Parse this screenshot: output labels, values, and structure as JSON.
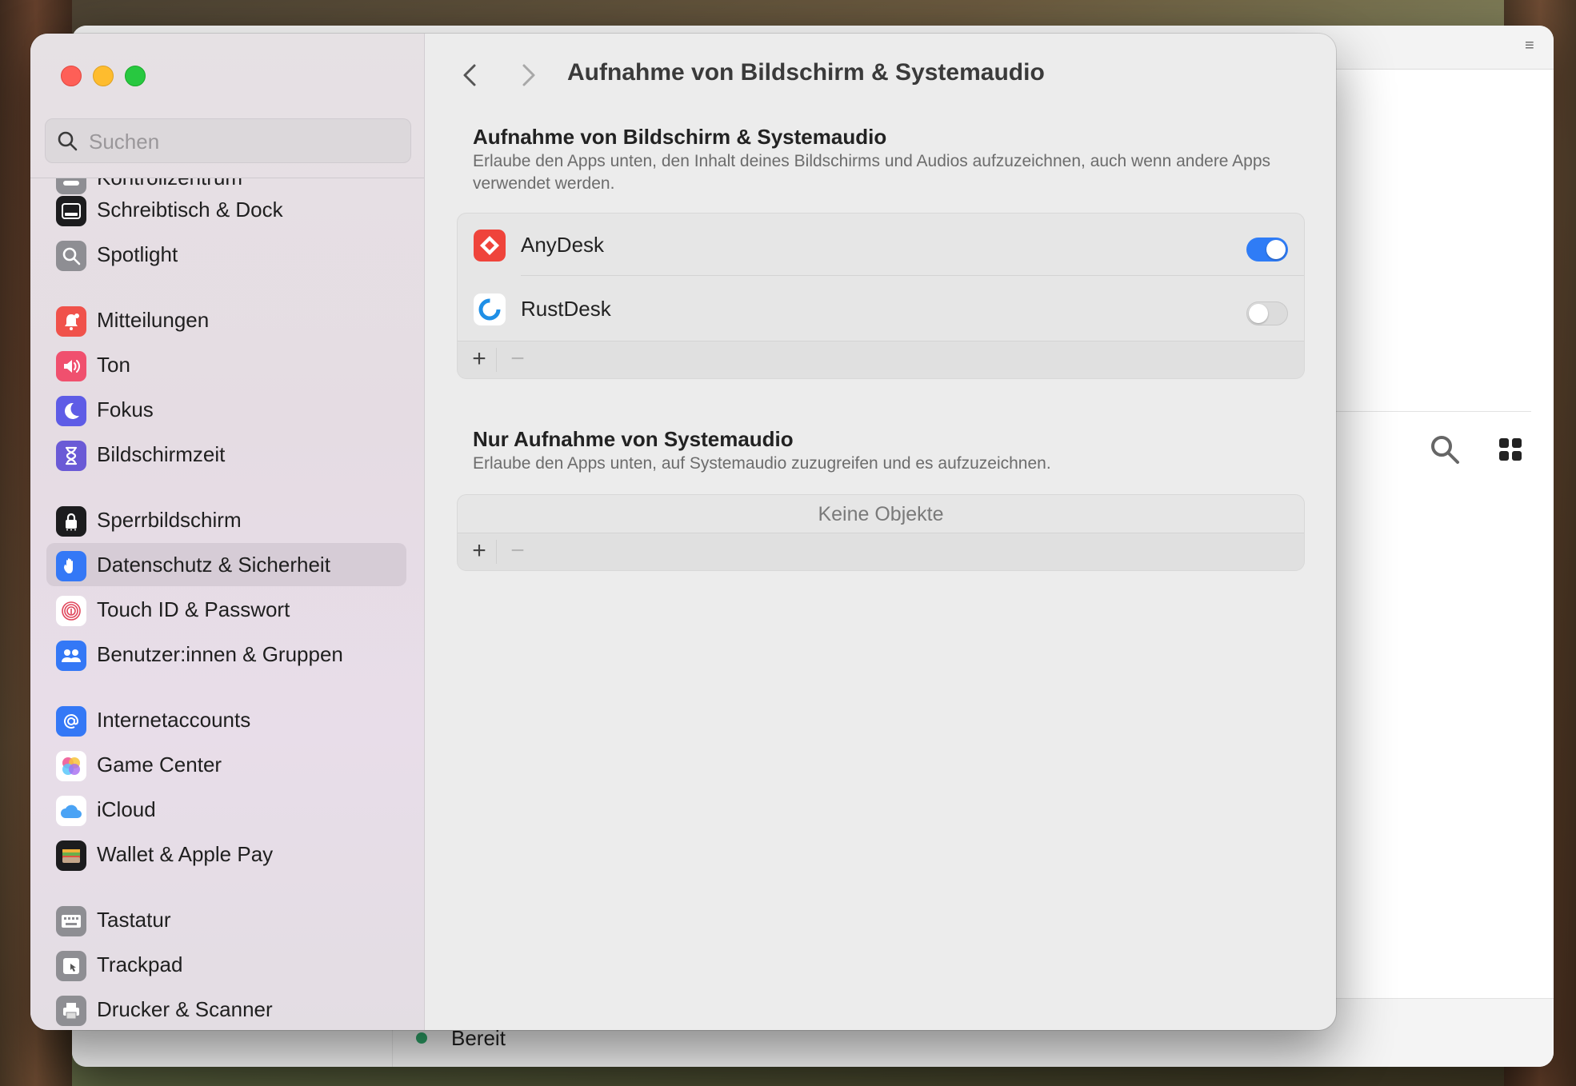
{
  "background_app": {
    "status_label": "Bereit"
  },
  "window": {
    "title": "Aufnahme von Bildschirm & Systemaudio"
  },
  "search": {
    "placeholder": "Suchen"
  },
  "sidebar": {
    "items": [
      {
        "label": "Kontrollzentrum",
        "icon": "control-center-icon",
        "color": "#8e8e93"
      },
      {
        "label": "Schreibtisch & Dock",
        "icon": "dock-icon",
        "color": "#1c1c1e"
      },
      {
        "label": "Spotlight",
        "icon": "spotlight-icon",
        "color": "#8e8e93"
      },
      {
        "label": "Mitteilungen",
        "icon": "notifications-icon",
        "color": "#f0524b"
      },
      {
        "label": "Ton",
        "icon": "sound-icon",
        "color": "#f0506e"
      },
      {
        "label": "Fokus",
        "icon": "focus-icon",
        "color": "#5e5ce6"
      },
      {
        "label": "Bildschirmzeit",
        "icon": "screen-time-icon",
        "color": "#6a5ad6"
      },
      {
        "label": "Sperrbildschirm",
        "icon": "lock-screen-icon",
        "color": "#1c1c1e"
      },
      {
        "label": "Datenschutz & Sicherheit",
        "icon": "privacy-hand-icon",
        "color": "#3478f6",
        "selected": true
      },
      {
        "label": "Touch ID & Passwort",
        "icon": "fingerprint-icon",
        "color": "#ffffff"
      },
      {
        "label": "Benutzer:innen & Gruppen",
        "icon": "users-icon",
        "color": "#3478f6"
      },
      {
        "label": "Internetaccounts",
        "icon": "at-sign-icon",
        "color": "#3478f6"
      },
      {
        "label": "Game Center",
        "icon": "game-center-icon",
        "color": "#ffffff"
      },
      {
        "label": "iCloud",
        "icon": "icloud-icon",
        "color": "#ffffff"
      },
      {
        "label": "Wallet & Apple Pay",
        "icon": "wallet-icon",
        "color": "#1c1c1e"
      },
      {
        "label": "Tastatur",
        "icon": "keyboard-icon",
        "color": "#8e8e93"
      },
      {
        "label": "Trackpad",
        "icon": "trackpad-icon",
        "color": "#8e8e93"
      },
      {
        "label": "Drucker & Scanner",
        "icon": "printer-icon",
        "color": "#8e8e93"
      }
    ]
  },
  "main": {
    "page_title": "Aufnahme von Bildschirm & Systemaudio",
    "section1": {
      "title": "Aufnahme von Bildschirm & Systemaudio",
      "description": "Erlaube den Apps unten, den Inhalt deines Bildschirms und Audios aufzuzeichnen, auch wenn andere Apps verwendet werden.",
      "apps": [
        {
          "name": "AnyDesk",
          "enabled": true,
          "icon": "anydesk-icon"
        },
        {
          "name": "RustDesk",
          "enabled": false,
          "icon": "rustdesk-icon"
        }
      ],
      "add_label": "+",
      "remove_label": "−"
    },
    "section2": {
      "title": "Nur Aufnahme von Systemaudio",
      "description": "Erlaube den Apps unten, auf Systemaudio zuzugreifen und es aufzuzeichnen.",
      "empty_label": "Keine Objekte",
      "add_label": "+",
      "remove_label": "−"
    }
  },
  "colors": {
    "accent": "#2f7cf6",
    "selection": "#d6ccd6"
  }
}
